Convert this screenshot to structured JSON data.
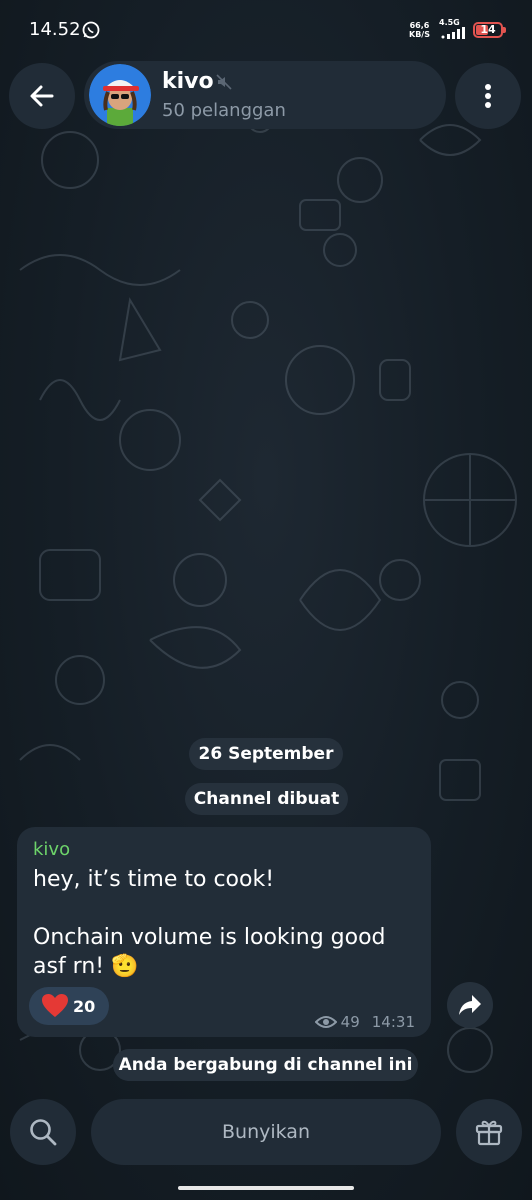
{
  "status_bar": {
    "time": "14.52",
    "net_speed_value": "66,6",
    "net_speed_unit": "KB/S",
    "network_type": "4.5G",
    "battery": "14"
  },
  "header": {
    "channel_name": "kivo",
    "subscribers": "50 pelanggan"
  },
  "chat": {
    "date_label": "26 September",
    "created_label": "Channel dibuat",
    "joined_label": "Anda bergabung di channel ini",
    "message": {
      "author": "kivo",
      "line1": "hey, it’s time to cook!",
      "line2": "Onchain volume is looking good asf rn! 🫡",
      "reaction_emoji": "heart",
      "reaction_count": "20",
      "views": "49",
      "time": "14:31"
    }
  },
  "bottom_bar": {
    "unmute_label": "Bunyikan"
  },
  "colors": {
    "background": "#131c24",
    "surface": "#212c37",
    "author": "#6dd36a",
    "reaction": "#2f4257",
    "heart": "#e53935",
    "battery_low": "#e25450"
  }
}
